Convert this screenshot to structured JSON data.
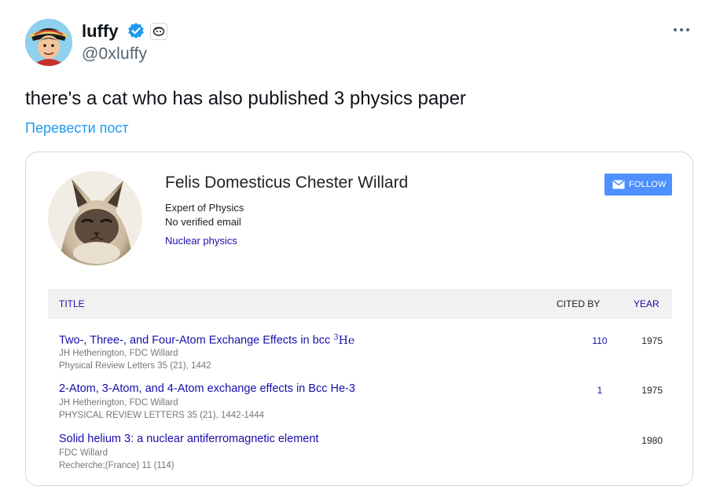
{
  "author": {
    "display_name": "luffy",
    "handle": "@0xluffy",
    "verified": true
  },
  "tweet": {
    "text": "there's a cat who has also published 3 physics paper",
    "translate_label": "Перевести пост"
  },
  "profile": {
    "name": "Felis Domesticus Chester Willard",
    "affiliation": "Expert of Physics",
    "email_status": "No verified email",
    "interest": "Nuclear physics",
    "follow_label": "FOLLOW"
  },
  "table": {
    "headers": {
      "title": "TITLE",
      "cited_by": "CITED BY",
      "year": "YEAR"
    },
    "rows": [
      {
        "title": "Two-, Three-, and Four-Atom Exchange Effects in bcc",
        "title_suffix_sup": "3",
        "title_suffix": "He",
        "authors": "JH Hetherington, FDC Willard",
        "venue": "Physical Review Letters 35 (21), 1442",
        "cited_by": "110",
        "year": "1975"
      },
      {
        "title": "2-Atom, 3-Atom, and 4-Atom exchange effects in Bcc He-3",
        "authors": "JH Hetherington, FDC Willard",
        "venue": "PHYSICAL REVIEW LETTERS 35 (21), 1442-1444",
        "cited_by": "1",
        "year": "1975"
      },
      {
        "title": "Solid helium 3: a nuclear antiferromagnetic element",
        "authors": "FDC Willard",
        "venue": "Recherche;(France) 11 (114)",
        "cited_by": "",
        "year": "1980"
      }
    ]
  },
  "colors": {
    "verified_blue": "#1d9bf0",
    "link_blue": "#1a0dab",
    "follow_button": "#4d90fe",
    "header_bg": "#f1f1f1"
  },
  "icons": {
    "verified": "verified-badge-icon",
    "affiliation": "affiliation-badge-icon",
    "more": "more-icon",
    "mail": "mail-icon"
  }
}
